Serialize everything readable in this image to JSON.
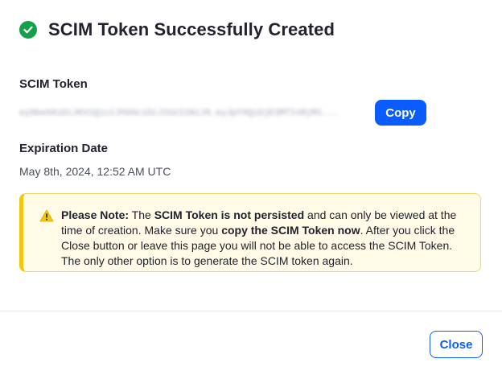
{
  "dialog": {
    "title": "SCIM Token Successfully Created",
    "status_color": "#15a04c",
    "accent_color": "#0b5cff"
  },
  "token": {
    "label": "SCIM Token",
    "value": "ey0beXAiOiJKV1QiLCJhbGciOiJIUzI1NiJ9.eyJpYXQiOjE3MTIxNjM1...",
    "copy_label": "Copy"
  },
  "expiration": {
    "label": "Expiration Date",
    "value": "May 8th, 2024, 12:52 AM UTC"
  },
  "note": {
    "icon": "warning-icon",
    "prefix": "Please Note:",
    "t1": " The ",
    "b1": "SCIM Token is not persisted",
    "t2": " and can only be viewed at the time of creation. Make sure you ",
    "b2": "copy the SCIM Token now",
    "t3": ". After you click the Close button or leave this page you will not be able to access the SCIM Token. The only other option is to generate the SCIM token again."
  },
  "footer": {
    "close_label": "Close"
  }
}
